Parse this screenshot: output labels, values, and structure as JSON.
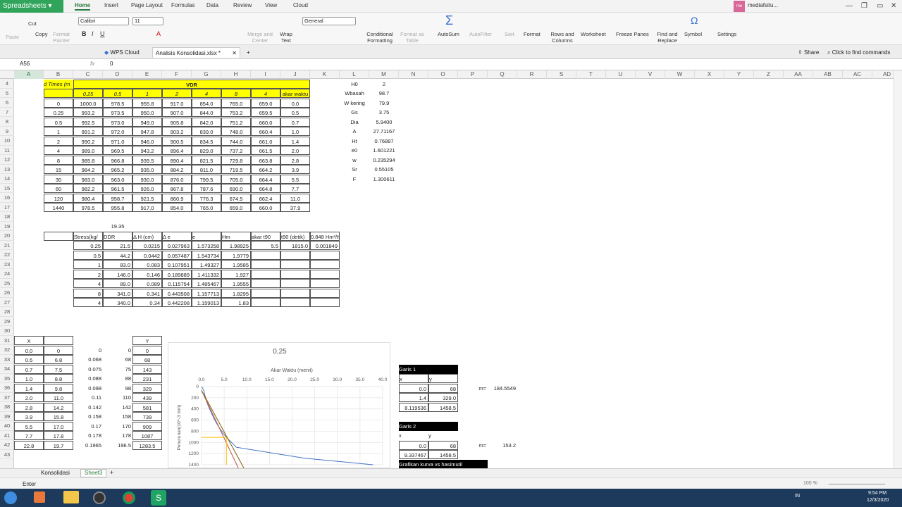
{
  "app": {
    "name": "Spreadsheets",
    "menus": [
      "Home",
      "Insert",
      "Page Layout",
      "Formulas",
      "Data",
      "Review",
      "View",
      "Cloud"
    ],
    "user": "mediafsitu..."
  },
  "ribbon": {
    "clipboard": [
      "Cut",
      "Copy",
      "Paste",
      "Format Painter"
    ],
    "font": {
      "name": "Calibri",
      "size": "11"
    },
    "number_format": "General",
    "labels": [
      "Merge and Center",
      "Wrap Text",
      "Conditional Formatting",
      "Format as Table",
      "AutoSum",
      "AutoFilter",
      "Sort",
      "Format",
      "Rows and Columns",
      "Worksheet",
      "Freeze Panes",
      "Find and Replace",
      "Symbol",
      "Settings"
    ]
  },
  "docbar": {
    "tabs": [
      "WPS Cloud",
      "Analisis Konsolidasi.xlsx *"
    ],
    "share": "Share",
    "find_commands": "Click to find commands"
  },
  "formula": {
    "cell_ref": "A56",
    "fx": "fx",
    "value": "0"
  },
  "columns": [
    "A",
    "B",
    "C",
    "D",
    "E",
    "F",
    "G",
    "H",
    "I",
    "J",
    "K",
    "L",
    "M",
    "N",
    "O",
    "P",
    "Q",
    "R",
    "S",
    "T",
    "U",
    "V",
    "W",
    "X",
    "Y",
    "Z",
    "AA",
    "AB",
    "AC",
    "AD"
  ],
  "row_numbers": [
    "4",
    "5",
    "6",
    "7",
    "8",
    "9",
    "10",
    "11",
    "12",
    "13",
    "14",
    "15",
    "16",
    "17",
    "18",
    "19",
    "20",
    "21",
    "22",
    "23",
    "24",
    "25",
    "26",
    "27",
    "28",
    "29",
    "30",
    "31",
    "32",
    "33",
    "34",
    "35",
    "36",
    "37",
    "38",
    "39",
    "40",
    "41",
    "42",
    "43"
  ],
  "table1": {
    "title": "VDR",
    "corner": "d Times (m",
    "stress_headers": [
      "0.25",
      "0.5",
      "1",
      "2",
      "4",
      "8",
      "4"
    ],
    "akar_header": "akar waktu",
    "rows": [
      [
        "0",
        "1000.0",
        "978.5",
        "955.8",
        "917.0",
        "854.0",
        "765.0",
        "659.0",
        "0.0"
      ],
      [
        "0.25",
        "993.2",
        "973.5",
        "950.0",
        "907.0",
        "844.0",
        "753.2",
        "659.5",
        "0.5"
      ],
      [
        "0.5",
        "992.5",
        "973.0",
        "949.0",
        "905.8",
        "842.0",
        "751.2",
        "660.0",
        "0.7"
      ],
      [
        "1",
        "991.2",
        "972.0",
        "947.8",
        "903.2",
        "839.0",
        "748.0",
        "660.4",
        "1.0"
      ],
      [
        "2",
        "990.2",
        "971.0",
        "946.0",
        "900.5",
        "834.5",
        "744.0",
        "661.0",
        "1.4"
      ],
      [
        "4",
        "989.0",
        "969.5",
        "943.2",
        "896.4",
        "829.0",
        "737.2",
        "661.5",
        "2.0"
      ],
      [
        "8",
        "985.8",
        "966.8",
        "939.5",
        "890.4",
        "821.5",
        "729.8",
        "663.8",
        "2.8"
      ],
      [
        "15",
        "984.2",
        "965.2",
        "935.0",
        "884.2",
        "811.0",
        "719.5",
        "664.2",
        "3.9"
      ],
      [
        "30",
        "983.0",
        "963.0",
        "930.0",
        "876.0",
        "799.5",
        "705.0",
        "664.4",
        "5.5"
      ],
      [
        "60",
        "982.2",
        "961.5",
        "926.0",
        "867.8",
        "787.6",
        "690.0",
        "664.8",
        "7.7"
      ],
      [
        "120",
        "980.4",
        "958.7",
        "921.5",
        "860.9",
        "776.3",
        "674.5",
        "662.4",
        "11.0"
      ],
      [
        "1440",
        "978.5",
        "955.8",
        "917.0",
        "854.0",
        "765.0",
        "659.0",
        "660.0",
        "37.9"
      ]
    ]
  },
  "props": [
    [
      "H0",
      "2"
    ],
    [
      "Wbasah",
      "98.7"
    ],
    [
      "W kering",
      "79.9"
    ],
    [
      "Gs",
      "3.75"
    ],
    [
      "Dia",
      "5.9400"
    ],
    [
      "A",
      "27.71167"
    ],
    [
      "Ht",
      "0.76887"
    ],
    [
      "e0",
      "1.601221"
    ],
    [
      "w",
      "0.235294"
    ],
    [
      "Sr",
      "0.55105"
    ],
    [
      "F",
      "1.300611"
    ]
  ],
  "d19": "19.35",
  "table2": {
    "headers": [
      "Stress(kg/",
      "DDR",
      "Δ H (cm)",
      "Δ e",
      "e",
      "Hm",
      "akar t90",
      "t90 (detik)",
      "0.848 Hm²/t90"
    ],
    "rows": [
      [
        "0.25",
        "21.5",
        "0.0215",
        "0.027963",
        "1.573258",
        "1.98925",
        "5.5",
        "1815.0",
        "0.001849"
      ],
      [
        "0.5",
        "44.2",
        "0.0442",
        "0.057487",
        "1.543734",
        "1.9779",
        "",
        "",
        ""
      ],
      [
        "1",
        "83.0",
        "0.083",
        "0.107951",
        "1.49327",
        "1.9585",
        "",
        "",
        ""
      ],
      [
        "2",
        "146.0",
        "0.146",
        "0.189889",
        "1.411332",
        "1.927",
        "",
        "",
        ""
      ],
      [
        "4",
        "89.0",
        "0.089",
        "0.115754",
        "1.485467",
        "1.9555",
        "",
        "",
        ""
      ],
      [
        "8",
        "341.0",
        "0.341",
        "0.443508",
        "1.157713",
        "1.8295",
        "",
        "",
        ""
      ],
      [
        "4",
        "340.0",
        "0.34",
        "0.442208",
        "1.159013",
        "1.83",
        "",
        "",
        ""
      ]
    ]
  },
  "table3": {
    "x_header": "X",
    "y_header": "Y",
    "rows": [
      [
        "0.0",
        "0",
        "0",
        "0",
        "0"
      ],
      [
        "0.5",
        "6.8",
        "0.068",
        "68",
        "68"
      ],
      [
        "0.7",
        "7.5",
        "0.075",
        "75",
        "143"
      ],
      [
        "1.0",
        "8.8",
        "0.088",
        "88",
        "231"
      ],
      [
        "1.4",
        "9.8",
        "0.098",
        "98",
        "329"
      ],
      [
        "2.0",
        "11.0",
        "0.11",
        "110",
        "439"
      ],
      [
        "2.8",
        "14.2",
        "0.142",
        "142",
        "581"
      ],
      [
        "3.9",
        "15.8",
        "0.158",
        "158",
        "739"
      ],
      [
        "5.5",
        "17.0",
        "0.17",
        "170",
        "909"
      ],
      [
        "7.7",
        "17.8",
        "0.178",
        "178",
        "1087"
      ],
      [
        "22.8",
        "19.7",
        "0.1965",
        "196.5",
        "1283.5"
      ]
    ]
  },
  "garis1": {
    "title": "Garis 1",
    "xy": [
      "x",
      "y"
    ],
    "rows": [
      [
        "0.0",
        "68"
      ],
      [
        "1.4",
        "329.0"
      ],
      [
        "8.119536",
        "1458.5"
      ]
    ],
    "m_label": "m=",
    "m": "184.5549"
  },
  "garis2": {
    "title": "Garis 2",
    "xy": [
      "x",
      "y"
    ],
    "rows": [
      [
        "0.0",
        "68"
      ],
      [
        "9.337467",
        "1458.5"
      ]
    ],
    "m_label": "m=",
    "m": "153.2"
  },
  "next_label": "Grafikan kurva vs hasimutil",
  "chart_data": {
    "type": "line",
    "title": "0,25",
    "xlabel": "Akar Waktu (menit)",
    "ylabel": "Penurunan(10^-3 mm)",
    "x_ticks": [
      "0.0",
      "5.0",
      "10.0",
      "15.0",
      "20.0",
      "25.0",
      "30.0",
      "35.0",
      "40.0"
    ],
    "y_ticks": [
      "0",
      "200",
      "400",
      "600",
      "800",
      "1000",
      "1200",
      "1400"
    ],
    "xlim": [
      0,
      40
    ],
    "ylim": [
      0,
      1400
    ],
    "series": [
      {
        "color": "#4472c4",
        "x": [
          0.0,
          0.5,
          0.7,
          1.0,
          1.4,
          2.0,
          2.8,
          3.9,
          5.5,
          7.7,
          22.8,
          37.9
        ],
        "y": [
          0,
          68,
          143,
          231,
          329,
          439,
          581,
          739,
          909,
          1087,
          1283.5,
          1400
        ]
      },
      {
        "color": "#c0504d",
        "x": [
          0.0,
          8.12
        ],
        "y": [
          68,
          1458.5
        ]
      },
      {
        "color": "#7f6000",
        "x": [
          0.0,
          9.34
        ],
        "y": [
          68,
          1458.5
        ]
      },
      {
        "color": "#ffc000",
        "x": [
          0.0,
          5.5,
          5.5
        ],
        "y": [
          909,
          909,
          1400
        ]
      }
    ]
  },
  "sheets": [
    "Konsolidasi",
    "Sheet3"
  ],
  "status": {
    "mode": "Enter",
    "zoom": "100 %"
  },
  "clock": {
    "time": "9:54 PM",
    "date": "12/3/2020",
    "lang": "IN"
  }
}
